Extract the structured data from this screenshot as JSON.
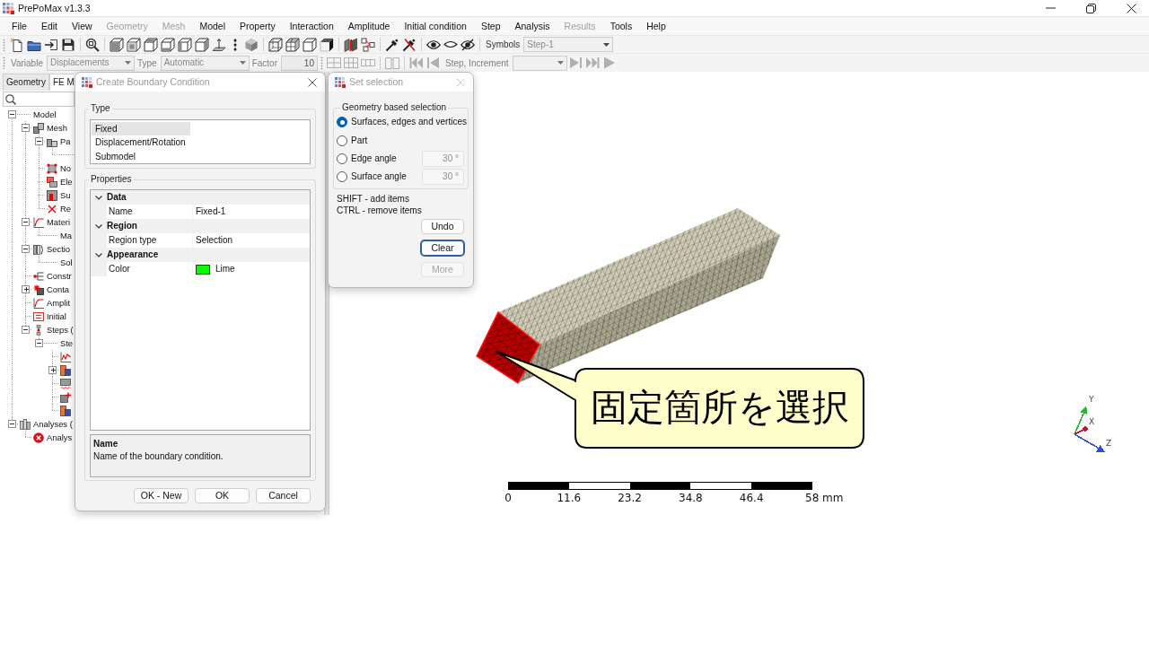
{
  "window": {
    "title": "PrePoMax v1.3.3"
  },
  "menu": [
    {
      "label": "File",
      "disabled": false
    },
    {
      "label": "Edit",
      "disabled": false
    },
    {
      "label": "View",
      "disabled": false
    },
    {
      "label": "Geometry",
      "disabled": true
    },
    {
      "label": "Mesh",
      "disabled": true
    },
    {
      "label": "Model",
      "disabled": false
    },
    {
      "label": "Property",
      "disabled": false
    },
    {
      "label": "Interaction",
      "disabled": false
    },
    {
      "label": "Amplitude",
      "disabled": false
    },
    {
      "label": "Initial condition",
      "disabled": false
    },
    {
      "label": "Step",
      "disabled": false
    },
    {
      "label": "Analysis",
      "disabled": false
    },
    {
      "label": "Results",
      "disabled": true
    },
    {
      "label": "Tools",
      "disabled": false
    },
    {
      "label": "Help",
      "disabled": false
    }
  ],
  "toolbar_1": {
    "symbols": {
      "label": "Symbols",
      "value": "Step-1",
      "disabled": true
    }
  },
  "toolbar_2": [
    {
      "kind": "dropdown",
      "label": "Variable",
      "value": "Displacements",
      "disabled": true
    },
    {
      "kind": "dropdown",
      "label": "Type",
      "value": "Automatic",
      "disabled": true
    },
    {
      "kind": "number",
      "label": "Factor",
      "value": "10",
      "disabled": true
    },
    {
      "kind": "icon",
      "disabled": true
    },
    {
      "kind": "icon",
      "disabled": true
    },
    {
      "kind": "icon",
      "disabled": true
    },
    {
      "kind": "icon",
      "disabled": true
    },
    {
      "kind": "icon",
      "disabled": true
    },
    {
      "kind": "icon",
      "disabled": true
    },
    {
      "kind": "dropdown",
      "label": "Step, Increment",
      "disabled": true
    },
    {
      "kind": "icon",
      "disabled": true
    },
    {
      "kind": "icon",
      "disabled": true
    },
    {
      "kind": "icon",
      "disabled": true
    }
  ],
  "tabs": [
    {
      "label": "Geometry",
      "selected": false
    },
    {
      "label": "FE M",
      "selected": true
    }
  ],
  "tree": [
    {
      "kind": "plain",
      "label": "Model",
      "expanded": true,
      "children": [
        {
          "kind": "icon",
          "label": "Mesh",
          "expanded": true,
          "children": [
            {
              "kind": "icon",
              "label": "Pa",
              "expanded": true,
              "children": [
                {
                  "kind": "plain"
                }
              ]
            },
            {
              "kind": "icon",
              "label": "No"
            },
            {
              "kind": "icon",
              "label": "Ele"
            },
            {
              "kind": "icon",
              "label": "Su"
            },
            {
              "kind": "icon",
              "label": "Re"
            }
          ]
        },
        {
          "kind": "icon",
          "label": "Materi",
          "expanded": true,
          "children": [
            {
              "kind": "plain",
              "label": "Ma"
            }
          ]
        },
        {
          "kind": "icon",
          "label": "Sectio",
          "expanded": true,
          "children": [
            {
              "kind": "plain",
              "label": "Sol"
            }
          ]
        },
        {
          "kind": "icon",
          "label": "Constr"
        },
        {
          "kind": "icon",
          "label": "Conta",
          "expanded": false
        },
        {
          "kind": "icon",
          "label": "Amplit"
        },
        {
          "kind": "icon",
          "label": "Initial"
        },
        {
          "kind": "icon",
          "label": "Steps (",
          "expanded": true,
          "children": [
            {
              "kind": "plain",
              "label": "Ste",
              "expanded": true,
              "children": [
                {
                  "kind": "icon"
                },
                {
                  "kind": "icon",
                  "expanded": false
                },
                {
                  "kind": "icon"
                },
                {
                  "kind": "icon"
                },
                {
                  "kind": "icon"
                }
              ]
            }
          ]
        }
      ]
    },
    {
      "kind": "icon",
      "label": "Analyses (",
      "expanded": true,
      "children": [
        {
          "kind": "icon",
          "label": "Analys"
        }
      ]
    }
  ],
  "boundary_dialog": {
    "title": "Create Boundary Condition",
    "active": false,
    "close_disabled": false,
    "type_group": {
      "label": "Type",
      "items": [
        {
          "label": "Fixed",
          "selected": true
        },
        {
          "label": "Displacement/Rotation",
          "selected": false
        },
        {
          "label": "Submodel",
          "selected": false
        }
      ]
    },
    "properties_group": {
      "label": "Properties",
      "categories": [
        {
          "label": "Data",
          "expanded": true,
          "rows": [
            {
              "name": "Name",
              "value": "Fixed-1"
            }
          ]
        },
        {
          "label": "Region",
          "expanded": true,
          "rows": [
            {
              "name": "Region type",
              "value": "Selection"
            }
          ]
        },
        {
          "label": "Appearance",
          "expanded": true,
          "rows": [
            {
              "name": "Color",
              "value": "Lime",
              "color": "#00ff00"
            }
          ]
        }
      ]
    },
    "description": {
      "title": "Name",
      "text": "Name of the boundary condition."
    },
    "buttons": [
      {
        "label": "OK - New"
      },
      {
        "label": "OK"
      },
      {
        "label": "Cancel"
      }
    ]
  },
  "selection_dialog": {
    "title": "Set selection",
    "active": false,
    "close_disabled": true,
    "group_label": "Geometry based selection",
    "options": [
      {
        "label": "Surfaces, edges and vertices",
        "selected": true
      },
      {
        "label": "Part",
        "selected": false
      },
      {
        "label": "Edge angle",
        "selected": false,
        "angle": {
          "value": "30 °",
          "disabled": true
        }
      },
      {
        "label": "Surface angle",
        "selected": false,
        "angle": {
          "value": "30 °",
          "disabled": true
        }
      }
    ],
    "hints": [
      "SHIFT - add items",
      "CTRL - remove items"
    ],
    "buttons": [
      {
        "label": "Undo",
        "focused": false,
        "disabled": false
      },
      {
        "label": "Clear",
        "focused": true,
        "disabled": false
      },
      {
        "label": "More",
        "focused": false,
        "disabled": true
      }
    ]
  },
  "viewport": {
    "callout": {
      "text": "固定箇所を選択"
    },
    "axes": [
      {
        "label": "Y",
        "color": "#2db52d"
      },
      {
        "label": "X",
        "color": "#c8102e"
      },
      {
        "label": "Z",
        "color": "#2f4fd6"
      }
    ],
    "scale_bar": {
      "labels": [
        "0",
        "11.6",
        "23.2",
        "34.8",
        "46.4",
        "58 mm"
      ]
    }
  }
}
